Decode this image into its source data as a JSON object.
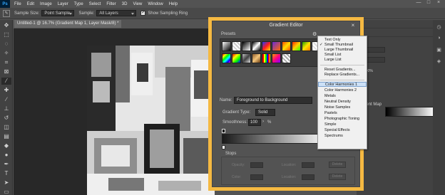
{
  "app": {
    "logo": "Ps",
    "menus": [
      "File",
      "Edit",
      "Image",
      "Layer",
      "Type",
      "Select",
      "Filter",
      "3D",
      "View",
      "Window",
      "Help"
    ],
    "window_controls": [
      "—",
      "□",
      "×"
    ]
  },
  "options_bar": {
    "sample_size_label": "Sample Size:",
    "sample_size_value": "Point Sample",
    "sample_label": "Sample:",
    "sample_value": "All Layers",
    "show_ring_label": "Show Sampling Ring"
  },
  "document": {
    "tab_title": "Untitled-1 @ 16.7% (Gradient Map 1, Layer Mask/8) *"
  },
  "right_panel": {
    "gradient_map_label": "ient Map",
    "percent_label": "100%"
  },
  "dialog": {
    "title": "Gradient Editor",
    "presets_label": "Presets",
    "name_label": "Name:",
    "name_value": "Foreground to Background",
    "gradient_type_label": "Gradient Type:",
    "gradient_type_value": "Solid",
    "smoothness_label": "Smoothness:",
    "smoothness_value": "100",
    "smoothness_unit": "%",
    "stops_label": "Stops",
    "opacity_label": "Opacity:",
    "color_label": "Color:",
    "location_label": "Location:",
    "delete_label": "Delete",
    "close_icon": "×"
  },
  "context_menu": {
    "items": [
      {
        "label": "Text Only",
        "checked": false
      },
      {
        "label": "Small Thumbnail",
        "checked": true
      },
      {
        "label": "Large Thumbnail",
        "checked": false
      },
      {
        "label": "Small List",
        "checked": false
      },
      {
        "label": "Large List",
        "checked": false
      },
      {
        "label": "Reset Gradients...",
        "checked": false
      },
      {
        "label": "Replace Gradients...",
        "checked": false
      },
      {
        "label": "Color Harmonies 1",
        "checked": false,
        "highlighted": true
      },
      {
        "label": "Color Harmonies 2",
        "checked": false
      },
      {
        "label": "Metals",
        "checked": false
      },
      {
        "label": "Neutral Density",
        "checked": false
      },
      {
        "label": "Noise Samples",
        "checked": false
      },
      {
        "label": "Pastels",
        "checked": false
      },
      {
        "label": "Photographic Toning",
        "checked": false
      },
      {
        "label": "Simple",
        "checked": false
      },
      {
        "label": "Special Effects",
        "checked": false
      },
      {
        "label": "Spectrums",
        "checked": false
      }
    ]
  },
  "colors": {
    "dialog_highlight": "#f5b942",
    "menu_highlight": "#cde1f7"
  }
}
